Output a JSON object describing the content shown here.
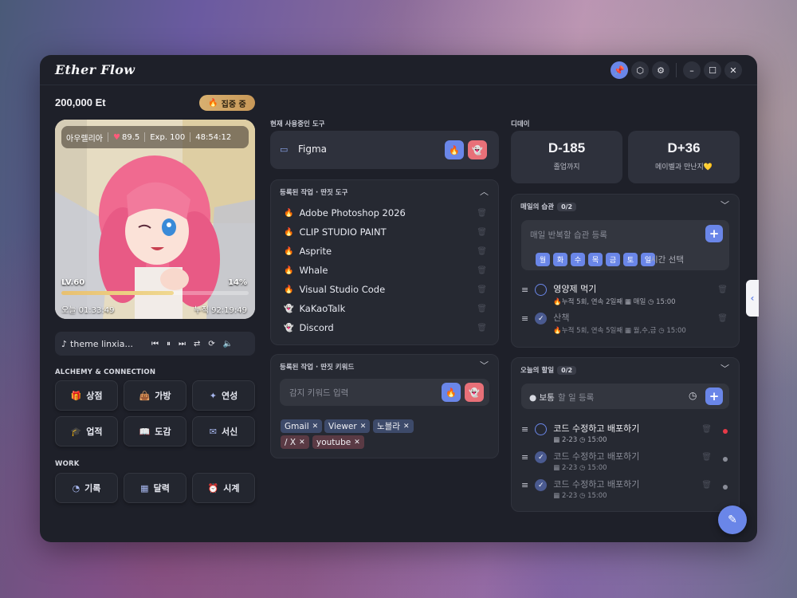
{
  "app": {
    "title": "Ether Flow"
  },
  "titlebar": {
    "icons": [
      "pin-icon",
      "cube-icon",
      "settings-icon",
      "minimize-icon",
      "maximize-icon",
      "close-icon"
    ]
  },
  "wallet": {
    "balance": "200,000 Et",
    "focus_label": "집중 중"
  },
  "character": {
    "name": "아우렐리아",
    "affinity": "89.5",
    "exp": "Exp. 100",
    "timer": "48:54:12",
    "level": "LV.60",
    "progress_pct": "14%",
    "progress": 0.6,
    "today": "오늘 01:33:49",
    "total": "누적 92:19:49"
  },
  "music": {
    "title": "theme linxia..."
  },
  "alchemy": {
    "label": "ALCHEMY & CONNECTION",
    "buttons": [
      "상점",
      "가방",
      "연성",
      "업적",
      "도감",
      "서신"
    ]
  },
  "work": {
    "label": "WORK",
    "buttons": [
      "기록",
      "달력",
      "시계"
    ]
  },
  "current_tool": {
    "label": "현재 사용중인 도구",
    "name": "Figma"
  },
  "registered_tools": {
    "label": "등록된 작업 · 딴짓 도구",
    "items": [
      {
        "name": "Adobe Photoshop 2026",
        "kind": "work"
      },
      {
        "name": "CLIP STUDIO PAINT",
        "kind": "work"
      },
      {
        "name": "Asprite",
        "kind": "work"
      },
      {
        "name": "Whale",
        "kind": "work"
      },
      {
        "name": "Visual Studio Code",
        "kind": "work"
      },
      {
        "name": "KaKaoTalk",
        "kind": "distraction"
      },
      {
        "name": "Discord",
        "kind": "distraction"
      }
    ]
  },
  "keywords": {
    "label": "등록된 작업 · 딴짓 키워드",
    "placeholder": "감지 키워드 입력",
    "chips": [
      {
        "text": "Gmail",
        "kind": "work"
      },
      {
        "text": "Viewer",
        "kind": "work"
      },
      {
        "text": "노블라",
        "kind": "work"
      },
      {
        "text": "/ X",
        "kind": "distraction"
      },
      {
        "text": "youtube",
        "kind": "distraction"
      }
    ]
  },
  "dday": {
    "label": "디데이",
    "items": [
      {
        "value": "D-185",
        "caption": "졸업까지"
      },
      {
        "value": "D+36",
        "caption": "메이벨과 만난지💛"
      }
    ]
  },
  "habits": {
    "label": "매일의 습관",
    "count": "0/2",
    "placeholder": "매일 반복할 습관 등록",
    "days": [
      "월",
      "화",
      "수",
      "목",
      "금",
      "토",
      "일"
    ],
    "time_label": "시간 선택",
    "items": [
      {
        "title": "영양제 먹기",
        "meta": "누적 5회, 연속 2일째",
        "repeat": "매일",
        "time": "15:00",
        "done": false
      },
      {
        "title": "산책",
        "meta": "누적 5회, 연속 5일째",
        "repeat": "월,수,금",
        "time": "15:00",
        "done": true
      }
    ]
  },
  "todos": {
    "label": "오늘의 할일",
    "count": "0/2",
    "priority": "보통",
    "placeholder": "할 일 등록",
    "items": [
      {
        "title": "코드 수정하고 배포하기",
        "date": "2-23",
        "time": "15:00",
        "done": false,
        "color": "#e83a48"
      },
      {
        "title": "코드 수정하고 배포하기",
        "date": "2-23",
        "time": "15:00",
        "done": true,
        "color": "#8a8d98"
      },
      {
        "title": "코드 수정하고 배포하기",
        "date": "2-23",
        "time": "15:00",
        "done": true,
        "color": "#8a8d98"
      }
    ]
  },
  "colors": {
    "accent": "#6a86e8",
    "danger": "#e87078",
    "gold": "#d8b070"
  }
}
